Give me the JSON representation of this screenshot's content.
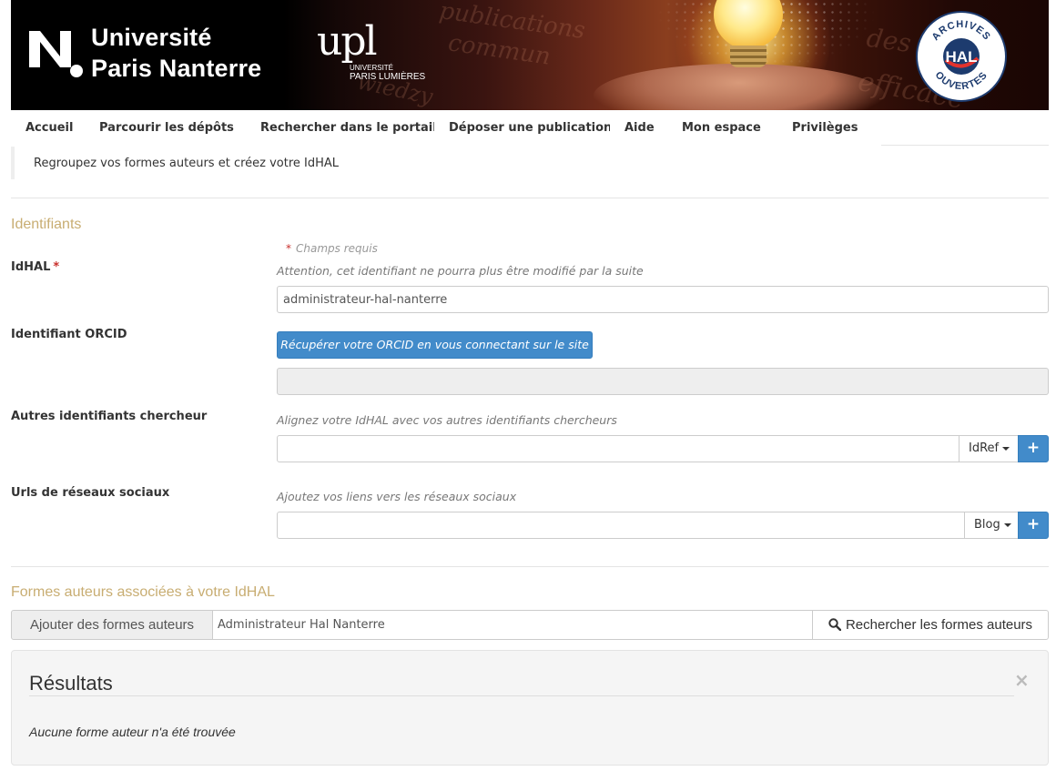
{
  "banner": {
    "university_line1": "Université",
    "university_line2": "Paris Nanterre",
    "upl_mark": "upl",
    "upl_line1": "UNIVERSITÉ",
    "upl_line2": "PARIS LUMIÈRES",
    "hal_top": "ARCHIVES",
    "hal_center": "HAL",
    "hal_bottom": "OUVERTES",
    "bg_words": [
      "publications",
      "commun",
      "efficace",
      "des",
      "wiedzy"
    ]
  },
  "nav": {
    "items": [
      {
        "label": "Accueil"
      },
      {
        "label": "Parcourir les dépôts"
      },
      {
        "label": "Rechercher dans le portail"
      },
      {
        "label": "Déposer une publication"
      },
      {
        "label": "Aide"
      },
      {
        "label": "Mon espace"
      },
      {
        "label": "Privilèges"
      }
    ]
  },
  "info_text": "Regroupez vos formes auteurs et créez votre IdHAL",
  "identifiants": {
    "title": "Identifiants",
    "required_note": "Champs requis",
    "required_mark": "*",
    "idhal": {
      "label": "IdHAL",
      "help": "Attention, cet identifiant ne pourra plus être modifié par la suite",
      "value": "administrateur-hal-nanterre"
    },
    "orcid": {
      "label": "Identifiant ORCID",
      "button": "Récupérer votre ORCID en vous connectant sur le site",
      "value": ""
    },
    "other_ids": {
      "label": "Autres identifiants chercheur",
      "help": "Alignez votre IdHAL avec vos autres identifiants chercheurs",
      "value": "",
      "dropdown": "IdRef",
      "add": "+"
    },
    "social": {
      "label": "Urls de réseaux sociaux",
      "help": "Ajoutez vos liens vers les réseaux sociaux",
      "value": "",
      "dropdown": "Blog",
      "add": "+"
    }
  },
  "formes": {
    "title": "Formes auteurs associées à votre IdHAL",
    "addon": "Ajouter des formes auteurs",
    "search_value": "Administrateur Hal Nanterre",
    "search_button": "Rechercher les formes auteurs",
    "search_icon": "search-icon"
  },
  "results": {
    "title": "Résultats",
    "close": "×",
    "empty": "Aucune forme auteur n'a été trouvée"
  },
  "colors": {
    "accent_title": "#c8ad72",
    "primary": "#428bca",
    "required": "#c9302c"
  }
}
